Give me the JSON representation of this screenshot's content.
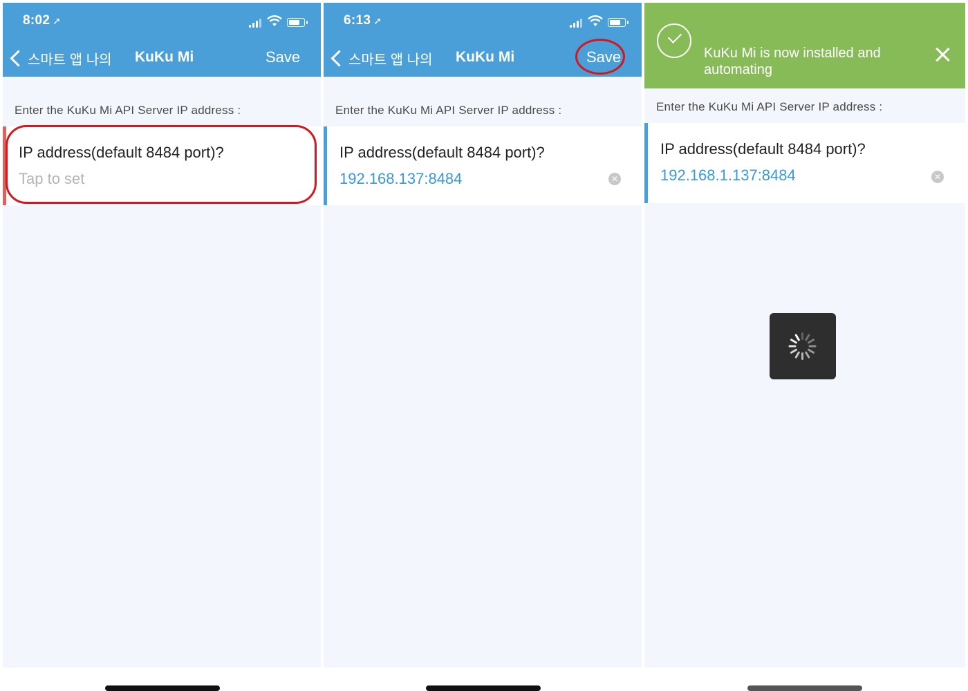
{
  "screens": [
    {
      "status": {
        "time": "8:02"
      },
      "nav": {
        "back_label": "스마트 앱 나의",
        "title": "KuKu Mi",
        "save_label": "Save"
      },
      "prompt": "Enter the KuKu Mi API Server IP address :",
      "field": {
        "label": "IP address(default 8484 port)?",
        "placeholder": "Tap to set"
      }
    },
    {
      "status": {
        "time": "6:13"
      },
      "nav": {
        "back_label": "스마트 앱 나의",
        "title": "KuKu Mi",
        "save_label": "Save"
      },
      "prompt": "Enter the KuKu Mi API Server IP address :",
      "field": {
        "label": "IP address(default 8484 port)?",
        "value": "192.168.137:8484"
      }
    },
    {
      "banner": {
        "message": "KuKu Mi is now installed and automating",
        "color": "#87bb57"
      },
      "prompt": "Enter the KuKu Mi API Server IP address :",
      "field": {
        "label": "IP address(default 8484 port)?",
        "value": "192.168.1.137:8484"
      }
    }
  ],
  "colors": {
    "nav_bar": "#4a9fd8",
    "field_value": "#3a98d8",
    "highlight_annotation": "#d4161d",
    "invalid_field_bar": "#d9635f"
  }
}
